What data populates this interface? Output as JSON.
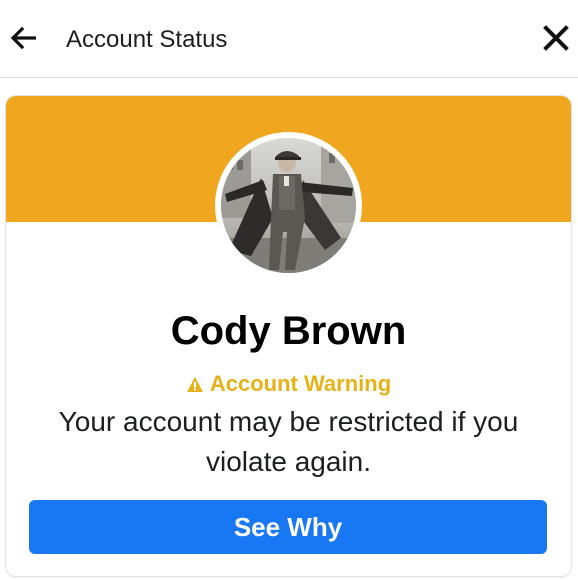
{
  "header": {
    "title": "Account Status",
    "back_icon": "arrow-left-icon",
    "close_icon": "close-icon"
  },
  "profile": {
    "name": "Cody Brown",
    "avatar": "profile-photo"
  },
  "warning": {
    "icon": "warning-triangle-icon",
    "label": "Account Warning",
    "message": "Your account may be restricted if you violate again."
  },
  "action": {
    "see_why_label": "See Why"
  },
  "colors": {
    "banner": "#f0a71f",
    "warning_text": "#e5b21a",
    "button": "#1877f2"
  }
}
